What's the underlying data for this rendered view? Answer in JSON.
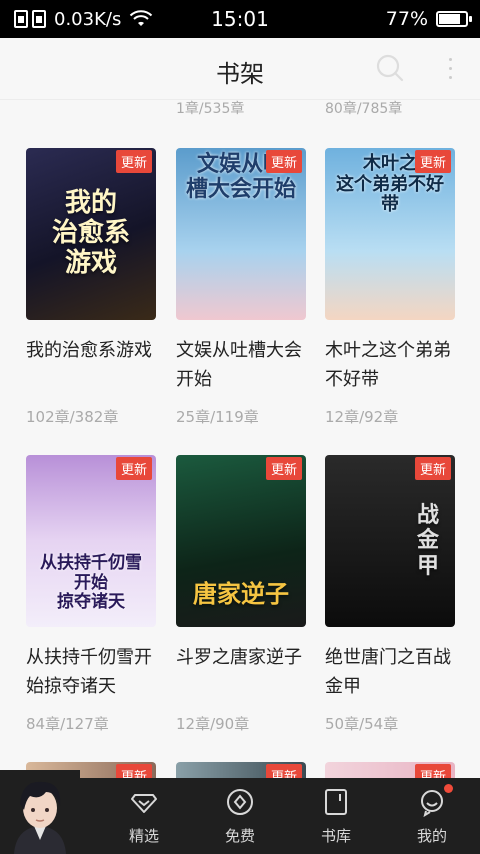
{
  "status_bar": {
    "speed": "0.03K/s",
    "time": "15:01",
    "battery": "77%",
    "battery_level": 0.77
  },
  "header": {
    "title": "书架",
    "icons": [
      "search-icon",
      "more-icon"
    ]
  },
  "partial_row": [
    "1章/535章",
    "80章/785章"
  ],
  "books": [
    {
      "name": "我的治愈系游戏",
      "progress": "102章/382章",
      "badge": "更新",
      "cover_text": "我的\n治愈系\n游戏",
      "cover_color": "#1c1c2e"
    },
    {
      "name": "文娱从吐槽大会开始",
      "progress": "25章/119章",
      "badge": "更新",
      "cover_text": "文娱从吐\n槽大会开始",
      "cover_color": "#7fb3d8"
    },
    {
      "name": "木叶之这个弟弟不好带",
      "progress": "12章/92章",
      "badge": "更新",
      "cover_text": "木叶之\n这个弟弟不好带",
      "cover_color": "#8ec6e6"
    },
    {
      "name": "从扶持千仞雪开始掠夺诸天",
      "progress": "84章/127章",
      "badge": "更新",
      "cover_text": "从扶持千仞雪\n开始\n掠夺诸天",
      "cover_color": "#a47cc4"
    },
    {
      "name": "斗罗之唐家逆子",
      "progress": "12章/90章",
      "badge": "更新",
      "cover_text": "唐家逆子",
      "cover_color": "#1f3a2a"
    },
    {
      "name": "绝世唐门之百战金甲",
      "progress": "50章/54章",
      "badge": "更新",
      "cover_text": "战\n金\n甲",
      "cover_color": "#161616"
    }
  ],
  "bottom_nav": [
    {
      "label": "精选",
      "icon": "diamond-icon"
    },
    {
      "label": "免费",
      "icon": "coin-icon"
    },
    {
      "label": "书库",
      "icon": "book-icon"
    },
    {
      "label": "我的",
      "icon": "profile-icon"
    }
  ],
  "colors": {
    "badge": "#e8483a",
    "nav_bg": "#1f1f1f",
    "dot": "#f04b3a"
  }
}
